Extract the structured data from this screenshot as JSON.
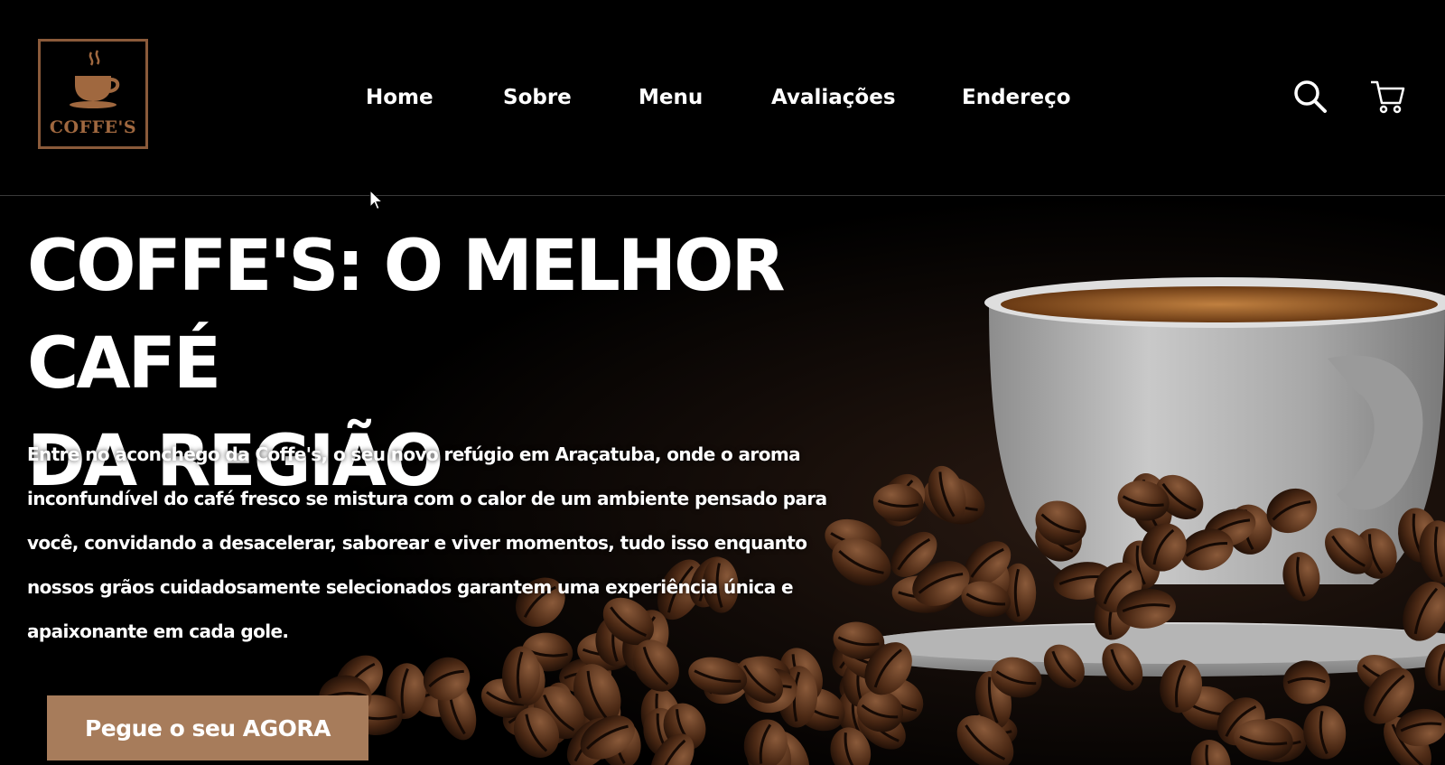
{
  "brand": {
    "logo_text": "COFFE'S",
    "accent_color": "#a0683f",
    "button_color": "#a77c5b"
  },
  "nav": {
    "items": [
      {
        "label": "Home"
      },
      {
        "label": "Sobre"
      },
      {
        "label": "Menu"
      },
      {
        "label": "Avaliações"
      },
      {
        "label": "Endereço"
      }
    ],
    "icons": [
      "search-icon",
      "cart-icon"
    ]
  },
  "hero": {
    "title_line1": "COFFE'S: O MELHOR CAFÉ",
    "title_line2": "DA REGIÃO",
    "text": "Entre no aconchego da Coffe's, o seu novo refúgio em Araçatuba, onde o aroma inconfundível do café fresco se mistura com o calor de um ambiente pensado para você, convidando a desacelerar, saborear e viver momentos, tudo isso enquanto nossos grãos cuidadosamente selecionados garantem uma experiência única e apaixonante em cada gole.",
    "cta_label": "Pegue o seu AGORA",
    "image": "coffee-cup-with-beans"
  }
}
